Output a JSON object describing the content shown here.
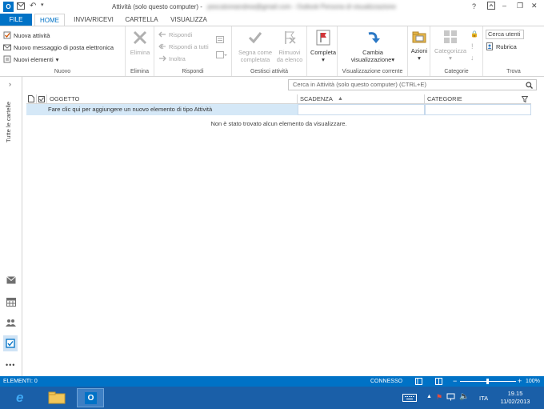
{
  "window": {
    "title": "Attività (solo questo computer) - ",
    "title_blurred": "pescatoreandrea@gmail.com - Outlook Persona di visualizzazione",
    "help": "?",
    "minimize": "–",
    "restore": "❐",
    "close": "✕"
  },
  "tabs": [
    {
      "label": "FILE"
    },
    {
      "label": "HOME"
    },
    {
      "label": "INVIA/RICEVI"
    },
    {
      "label": "CARTELLA"
    },
    {
      "label": "VISUALIZZA"
    }
  ],
  "ribbon": {
    "nuovo": {
      "label": "Nuovo",
      "new_task": "Nuova attività",
      "new_email": "Nuovo messaggio di posta elettronica",
      "new_items": "Nuovi elementi"
    },
    "elimina": {
      "label": "Elimina",
      "delete": "Elimina"
    },
    "rispondi": {
      "label": "Rispondi",
      "reply": "Rispondi",
      "reply_all": "Rispondi a tutti",
      "forward": "Inoltra"
    },
    "gestisci": {
      "label": "Gestisci attività",
      "mark_complete_1": "Segna come",
      "mark_complete_2": "completata",
      "remove_1": "Rimuovi",
      "remove_2": "da elenco"
    },
    "completa": {
      "label": "Completa"
    },
    "view": {
      "label": "Visualizzazione corrente",
      "change_1": "Cambia",
      "change_2": "visualizzazione"
    },
    "azioni": {
      "label": "Azioni"
    },
    "categorie": {
      "label": "Categorie",
      "categorize": "Categorizza"
    },
    "trova": {
      "label": "Trova",
      "search_people": "Cerca utenti",
      "address_book": "Rubrica"
    }
  },
  "nav": {
    "all_folders": "Tutte le cartelle",
    "more": "•••"
  },
  "search": {
    "placeholder": "Cerca in Attività (solo questo computer) (CTRL+E)"
  },
  "table": {
    "columns": [
      "OGGETTO",
      "SCADENZA",
      "CATEGORIE"
    ],
    "add_row": "Fare clic qui per aggiungere un nuovo elemento di tipo Attività",
    "empty": "Non è stato trovato alcun elemento da visualizzare."
  },
  "status": {
    "items": "ELEMENTI: 0",
    "connected": "CONNESSO",
    "zoom": "100%"
  },
  "taskbar": {
    "language": "ITA",
    "time": "19.15",
    "date": "11/02/2013"
  },
  "colors": {
    "accent": "#0072c6",
    "selection": "#d5e8f7",
    "taskbar": "#1a5fa8"
  }
}
